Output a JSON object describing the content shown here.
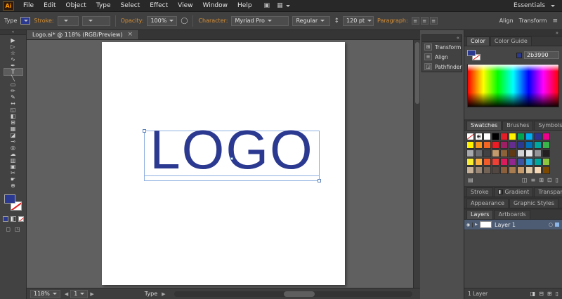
{
  "menu_bar": {
    "app_badge": "Ai",
    "items": [
      "File",
      "Edit",
      "Object",
      "Type",
      "Select",
      "Effect",
      "View",
      "Window",
      "Help"
    ],
    "workspace_label": "Essentials"
  },
  "control_bar": {
    "tool_label": "Type",
    "stroke_label": "Stroke:",
    "opacity_label": "Opacity:",
    "opacity_value": "100%",
    "character_label": "Character:",
    "font_family": "Myriad Pro",
    "font_style": "Regular",
    "font_size": "120 pt",
    "paragraph_label": "Paragraph:",
    "align_label": "Align",
    "transform_label": "Transform"
  },
  "document": {
    "tab_title": "Logo.ai* @ 118% (RGB/Preview)",
    "artboard_text": "LOGO",
    "text_color": "#2b3990"
  },
  "toolbar": {
    "tools": [
      {
        "name": "selection-tool",
        "glyph": "▶"
      },
      {
        "name": "direct-selection-tool",
        "glyph": "▷"
      },
      {
        "name": "magic-wand-tool",
        "glyph": "☆"
      },
      {
        "name": "lasso-tool",
        "glyph": "∿"
      },
      {
        "name": "pen-tool",
        "glyph": "✒"
      },
      {
        "name": "type-tool",
        "glyph": "T",
        "active": true
      },
      {
        "name": "line-segment-tool",
        "glyph": "╲"
      },
      {
        "name": "rectangle-tool",
        "glyph": "▭"
      },
      {
        "name": "paintbrush-tool",
        "glyph": "✏"
      },
      {
        "name": "pencil-tool",
        "glyph": "✎"
      },
      {
        "name": "width-tool",
        "glyph": "↔"
      },
      {
        "name": "free-transform-tool",
        "glyph": "◱"
      },
      {
        "name": "shape-builder-tool",
        "glyph": "◧"
      },
      {
        "name": "perspective-grid-tool",
        "glyph": "⊞"
      },
      {
        "name": "mesh-tool",
        "glyph": "▦"
      },
      {
        "name": "gradient-tool",
        "glyph": "◪"
      },
      {
        "name": "eyedropper-tool",
        "glyph": "⊸"
      },
      {
        "name": "blend-tool",
        "glyph": "◎"
      },
      {
        "name": "symbol-sprayer-tool",
        "glyph": "☁"
      },
      {
        "name": "column-graph-tool",
        "glyph": "▥"
      },
      {
        "name": "artboard-tool",
        "glyph": "▣"
      },
      {
        "name": "slice-tool",
        "glyph": "✂"
      },
      {
        "name": "hand-tool",
        "glyph": "☛"
      },
      {
        "name": "zoom-tool",
        "glyph": "⊕"
      }
    ]
  },
  "floating_panel": {
    "items": [
      {
        "name": "transform",
        "glyph": "⊞",
        "label": "Transform"
      },
      {
        "name": "align",
        "glyph": "≡",
        "label": "Align"
      },
      {
        "name": "pathfinder",
        "glyph": "◲",
        "label": "Pathfinder"
      }
    ]
  },
  "panels": {
    "color": {
      "tab_color": "Color",
      "tab_color_guide": "Color Guide",
      "hex": "2b3990"
    },
    "swatches": {
      "tab_swatches": "Swatches",
      "tab_brushes": "Brushes",
      "tab_symbols": "Symbols",
      "grid": [
        "none",
        "reg",
        "#ffffff",
        "#000000",
        "#e41e26",
        "#fff200",
        "#00a650",
        "#00adef",
        "#2e3192",
        "#ec008c",
        "#fff200",
        "#f7941d",
        "#f26522",
        "#ed1c24",
        "#9e1f63",
        "#662d91",
        "#2b3990",
        "#0072bc",
        "#00a99d",
        "#39b54a",
        "#a7a9ac",
        "#6d6e71",
        "#414042",
        "#c49a6c",
        "#8c6239",
        "#603913",
        "#d0d2d3",
        "#e6e7e8",
        "#939598",
        "#231f20",
        "#f9ed32",
        "#fbb040",
        "#f15a29",
        "#ef4136",
        "#da1c5c",
        "#92278f",
        "#3d52a1",
        "#27aae1",
        "#00a79d",
        "#8dc63f",
        "#c7b299",
        "#998675",
        "#736357",
        "#534741",
        "#8b5e3c",
        "#a97c50",
        "#c69c6d",
        "#e0c9a6",
        "#f4d7b5",
        "#7d4900"
      ]
    },
    "stroke_row": {
      "tab_stroke": "Stroke",
      "tab_gradient": "Gradient",
      "tab_transparency": "Transparency"
    },
    "appearance_row": {
      "tab_appearance": "Appearance",
      "tab_graphic_styles": "Graphic Styles"
    },
    "layers": {
      "tab_layers": "Layers",
      "tab_artboards": "Artboards",
      "layer_name": "Layer 1",
      "footer": "1 Layer"
    }
  },
  "status_bar": {
    "zoom": "118%",
    "artboard_number": "1",
    "tool_name": "Type"
  },
  "icons": {
    "close": "×",
    "panel_menu": "≡",
    "collapse_left": "«",
    "collapse_right": "»",
    "bridge": "▣",
    "arrange_docs": "▦",
    "align_text": "≡",
    "recolor": "◯",
    "size_stepper": "↕",
    "prev_arrow": "◀",
    "next_arrow": "▶",
    "eye": "◉",
    "layer_expand": "▶",
    "target_circle": "○",
    "swatch_libraries": "▤",
    "swatch_kinds": "◫",
    "new_color_group": "⊞",
    "new_swatch": "⊡",
    "delete_swatch": "▯",
    "clipping_mask": "◨",
    "new_sublayer": "⊟",
    "new_layer": "⊞",
    "delete_layer": "▯",
    "draw_mode": "◻",
    "screen_mode": "◳"
  }
}
